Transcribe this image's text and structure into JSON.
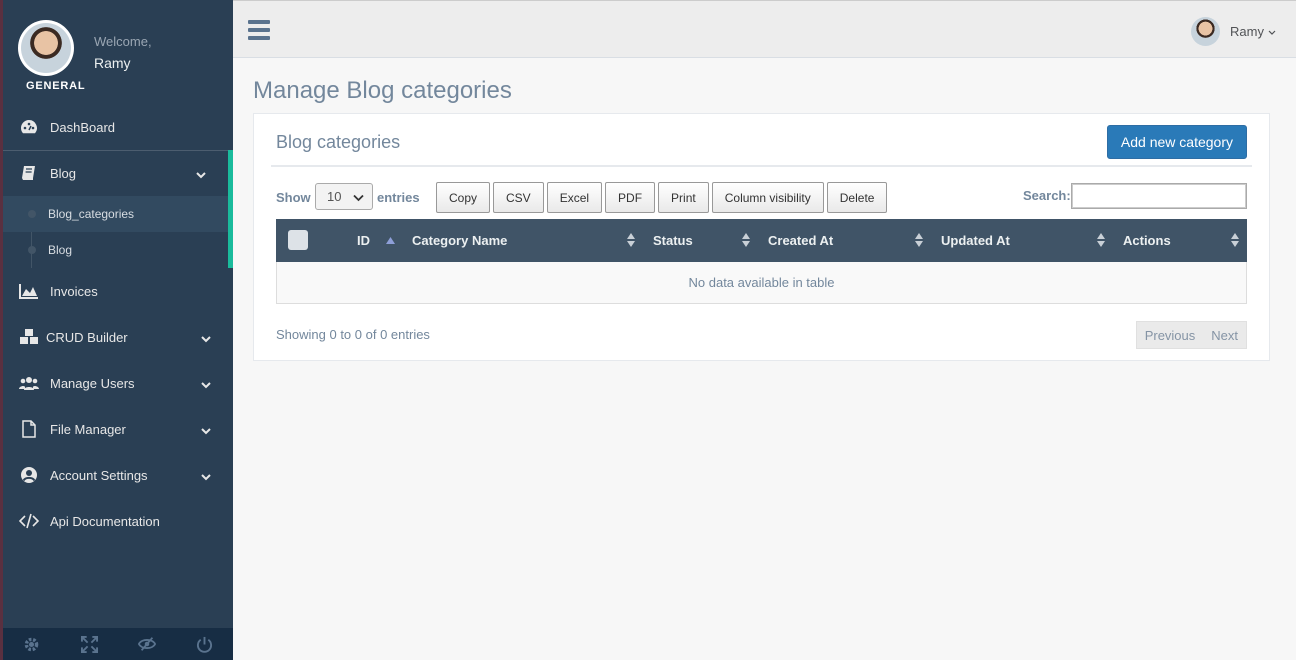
{
  "sidebar": {
    "welcome": "Welcome,",
    "user_name": "Ramy",
    "section": "GENERAL",
    "items": [
      {
        "label": "DashBoard",
        "icon": "palette-icon"
      },
      {
        "label": "Blog",
        "icon": "book-icon"
      },
      {
        "label": "Invoices",
        "icon": "area-chart-icon"
      },
      {
        "label": "CRUD Builder",
        "icon": "cubes-icon"
      },
      {
        "label": "Manage Users",
        "icon": "users-icon"
      },
      {
        "label": "File Manager",
        "icon": "file-icon"
      },
      {
        "label": "Account Settings",
        "icon": "user-circle-icon"
      },
      {
        "label": "Api Documentation",
        "icon": "code-icon"
      }
    ],
    "blog_sub": [
      {
        "label": "Blog_categories"
      },
      {
        "label": "Blog"
      }
    ],
    "footer_icons": [
      "gear-icon",
      "fullscreen-icon",
      "eye-slash-icon",
      "power-icon"
    ]
  },
  "topnav": {
    "user_name": "Ramy"
  },
  "page": {
    "title": "Manage Blog categories"
  },
  "panel": {
    "title": "Blog categories",
    "add_button": "Add new category",
    "show_label": "Show",
    "entries_label": "entries",
    "page_length": "10",
    "buttons": [
      "Copy",
      "CSV",
      "Excel",
      "PDF",
      "Print",
      "Column visibility",
      "Delete"
    ],
    "search_label": "Search:",
    "search_value": "",
    "columns": [
      "ID",
      "Category Name",
      "Status",
      "Created At",
      "Updated At",
      "Actions"
    ],
    "empty_text": "No data available in table",
    "info": "Showing 0 to 0 of 0 entries",
    "prev": "Previous",
    "next": "Next"
  },
  "colors": {
    "sidebar_bg": "#2a3f54",
    "accent": "#1abb9c",
    "primary_button": "#2a7ab8",
    "table_header": "#405467"
  }
}
